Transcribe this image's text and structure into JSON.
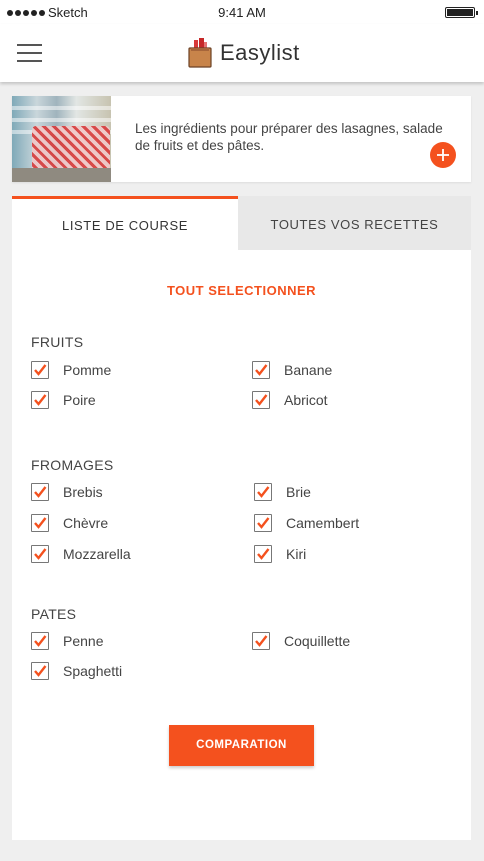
{
  "status_bar": {
    "carrier": "Sketch",
    "time": "9:41 AM"
  },
  "header": {
    "app_name": "Easylist"
  },
  "banner": {
    "text": "Les ingrédients pour préparer des lasagnes, salade de fruits et des pâtes."
  },
  "tabs": [
    {
      "label": "LISTE DE COURSE",
      "active": true
    },
    {
      "label": "TOUTES VOS RECETTES",
      "active": false
    }
  ],
  "select_all_label": "TOUT SELECTIONNER",
  "sections": [
    {
      "title": "FRUITS",
      "items": [
        {
          "label": "Pomme",
          "checked": true
        },
        {
          "label": "Banane",
          "checked": true
        },
        {
          "label": "Poire",
          "checked": true
        },
        {
          "label": "Abricot",
          "checked": true
        }
      ]
    },
    {
      "title": "FROMAGES",
      "items": [
        {
          "label": "Brebis",
          "checked": true
        },
        {
          "label": "Brie",
          "checked": true
        },
        {
          "label": "Chèvre",
          "checked": true
        },
        {
          "label": "Camembert",
          "checked": true
        },
        {
          "label": "Mozzarella",
          "checked": true
        },
        {
          "label": "Kiri",
          "checked": true
        }
      ]
    },
    {
      "title": "PATES",
      "items": [
        {
          "label": "Penne",
          "checked": true
        },
        {
          "label": "Coquillette",
          "checked": true
        },
        {
          "label": "Spaghetti",
          "checked": true
        }
      ]
    }
  ],
  "compare_button_label": "COMPARATION",
  "colors": {
    "accent": "#f4511e",
    "background": "#efefef",
    "inactive_tab": "#e8e8e8"
  },
  "icons": [
    "menu-icon",
    "basket-logo-icon",
    "plus-icon",
    "checkmark-icon",
    "battery-icon"
  ]
}
